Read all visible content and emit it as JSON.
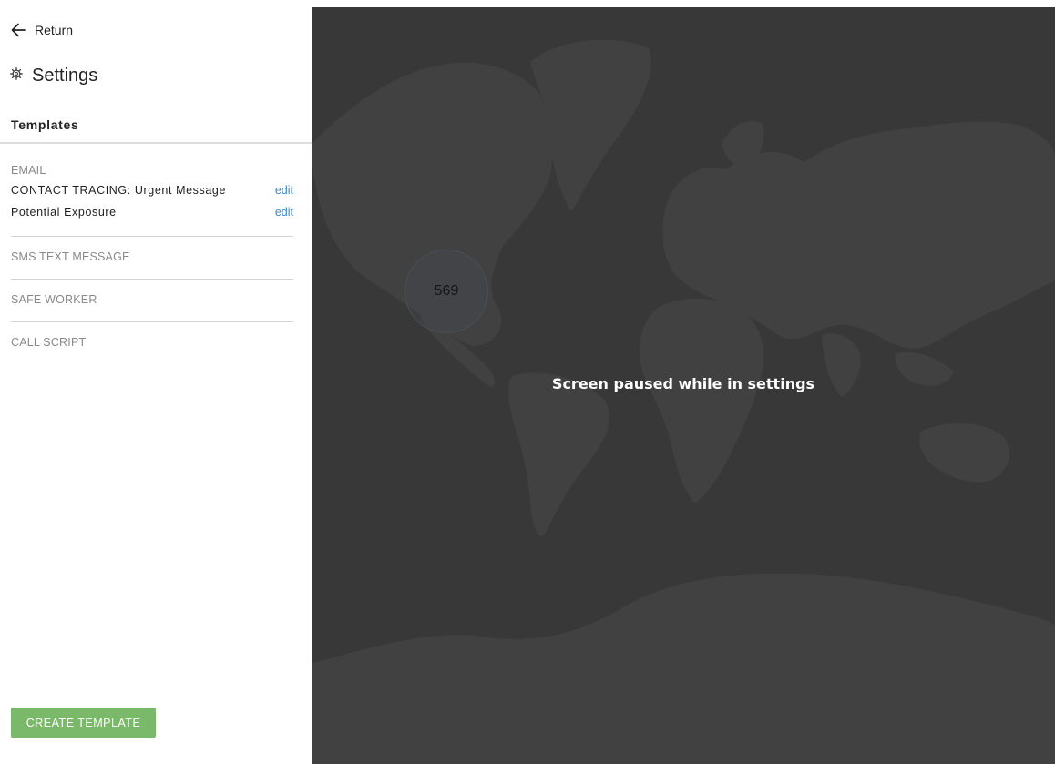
{
  "sidebar": {
    "return_label": "Return",
    "settings_title": "Settings",
    "section_title": "Templates",
    "groups": {
      "email": {
        "label": "EMAIL",
        "templates": [
          {
            "name": "CONTACT TRACING: Urgent Message",
            "action": "edit"
          },
          {
            "name": "Potential Exposure",
            "action": "edit"
          }
        ]
      },
      "sms": {
        "label": "SMS TEXT MESSAGE"
      },
      "safe_worker": {
        "label": "SAFE WORKER"
      },
      "call_script": {
        "label": "CALL SCRIPT"
      }
    },
    "create_button": "CREATE TEMPLATE"
  },
  "map": {
    "cluster_count": "569",
    "paused_message": "Screen paused while in settings"
  },
  "colors": {
    "accent_button": "#7ab86a",
    "link": "#3e88c3",
    "map_background": "#383838",
    "land": "#414141"
  },
  "icons": {
    "return": "arrow-left-icon",
    "settings": "gear-icon"
  }
}
